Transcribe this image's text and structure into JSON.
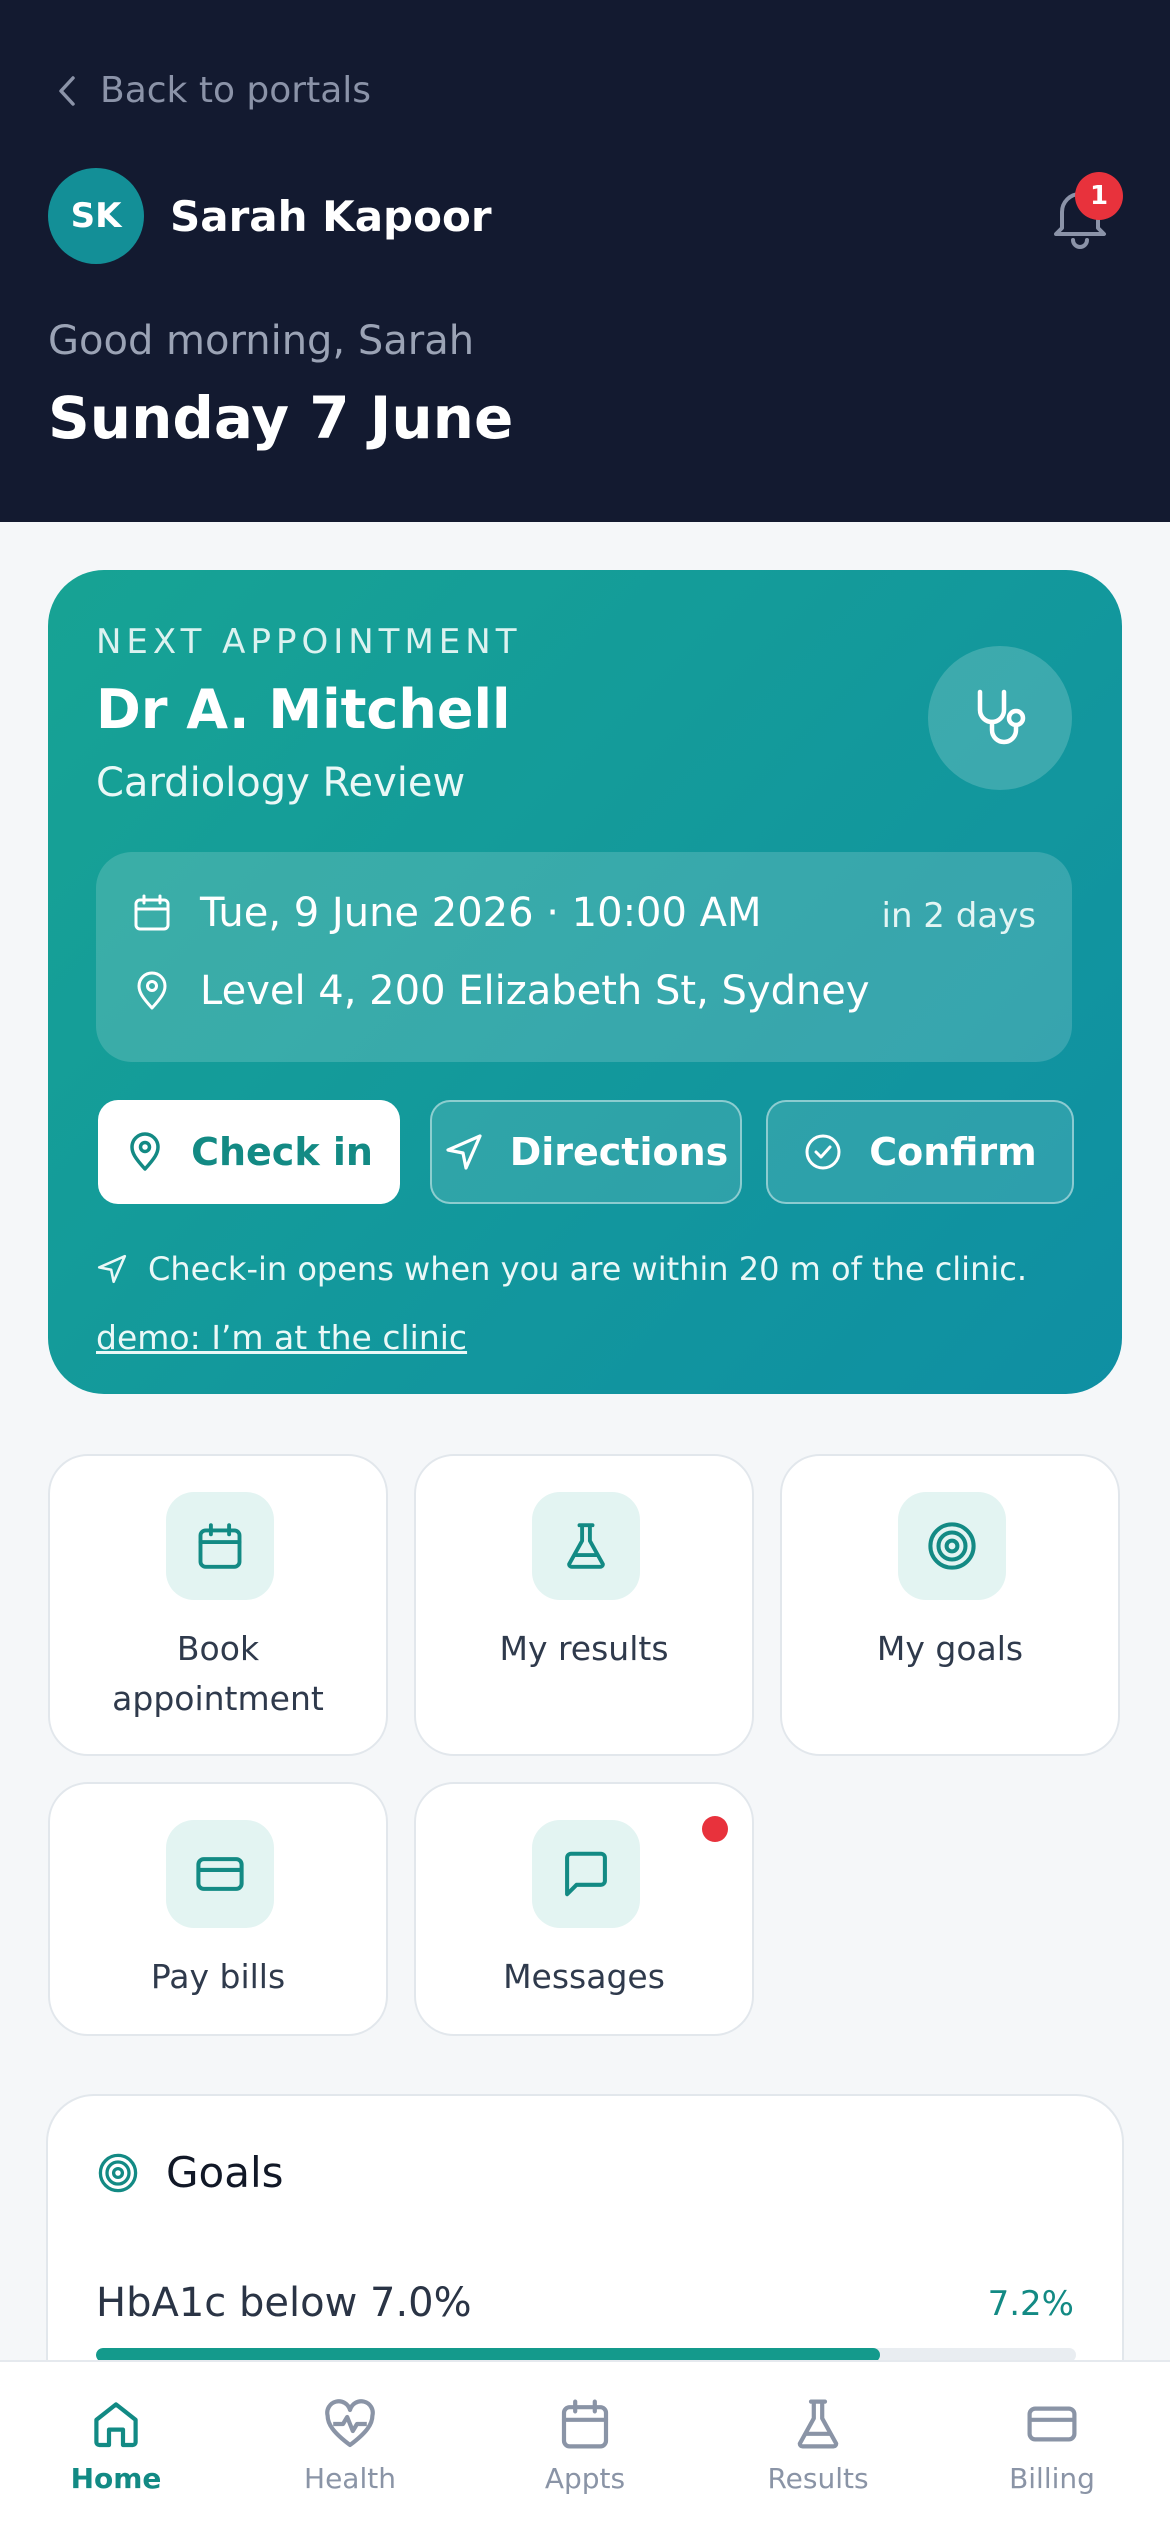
{
  "header": {
    "back_label": "Back to portals",
    "avatar_initials": "SK",
    "user_name": "Sarah Kapoor",
    "notification_count": "1",
    "greeting": "Good morning, Sarah",
    "date": "Sunday 7 June"
  },
  "appointment": {
    "eyebrow": "NEXT APPOINTMENT",
    "doctor": "Dr A. Mitchell",
    "type": "Cardiology Review",
    "datetime": "Tue, 9 June 2026 · 10:00 AM",
    "relative": "in 2 days",
    "location": "Level 4, 200 Elizabeth St, Sydney",
    "checkin_label": "Check in",
    "directions_label": "Directions",
    "confirm_label": "Confirm",
    "note": "Check-in opens when you are within 20 m of the clinic.",
    "demo_link": "demo: I’m at the clinic"
  },
  "quick_actions": [
    {
      "label": "Book appointment",
      "icon": "calendar-icon"
    },
    {
      "label": "My results",
      "icon": "flask-icon"
    },
    {
      "label": "My goals",
      "icon": "target-icon"
    },
    {
      "label": "Pay bills",
      "icon": "credit-card-icon"
    },
    {
      "label": "Messages",
      "icon": "message-icon",
      "unread": true
    }
  ],
  "goals": {
    "title": "Goals",
    "items": [
      {
        "name": "HbA1c below 7.0%",
        "value": "7.2%",
        "progress": 0.8
      }
    ]
  },
  "nav": {
    "items": [
      {
        "label": "Home",
        "icon": "home-icon",
        "active": true
      },
      {
        "label": "Health",
        "icon": "heart-pulse-icon"
      },
      {
        "label": "Appts",
        "icon": "calendar-icon"
      },
      {
        "label": "Results",
        "icon": "flask-icon"
      },
      {
        "label": "Billing",
        "icon": "credit-card-icon"
      }
    ]
  },
  "colors": {
    "header_bg": "#131a30",
    "accent": "#138a84",
    "badge": "#e8323c"
  }
}
